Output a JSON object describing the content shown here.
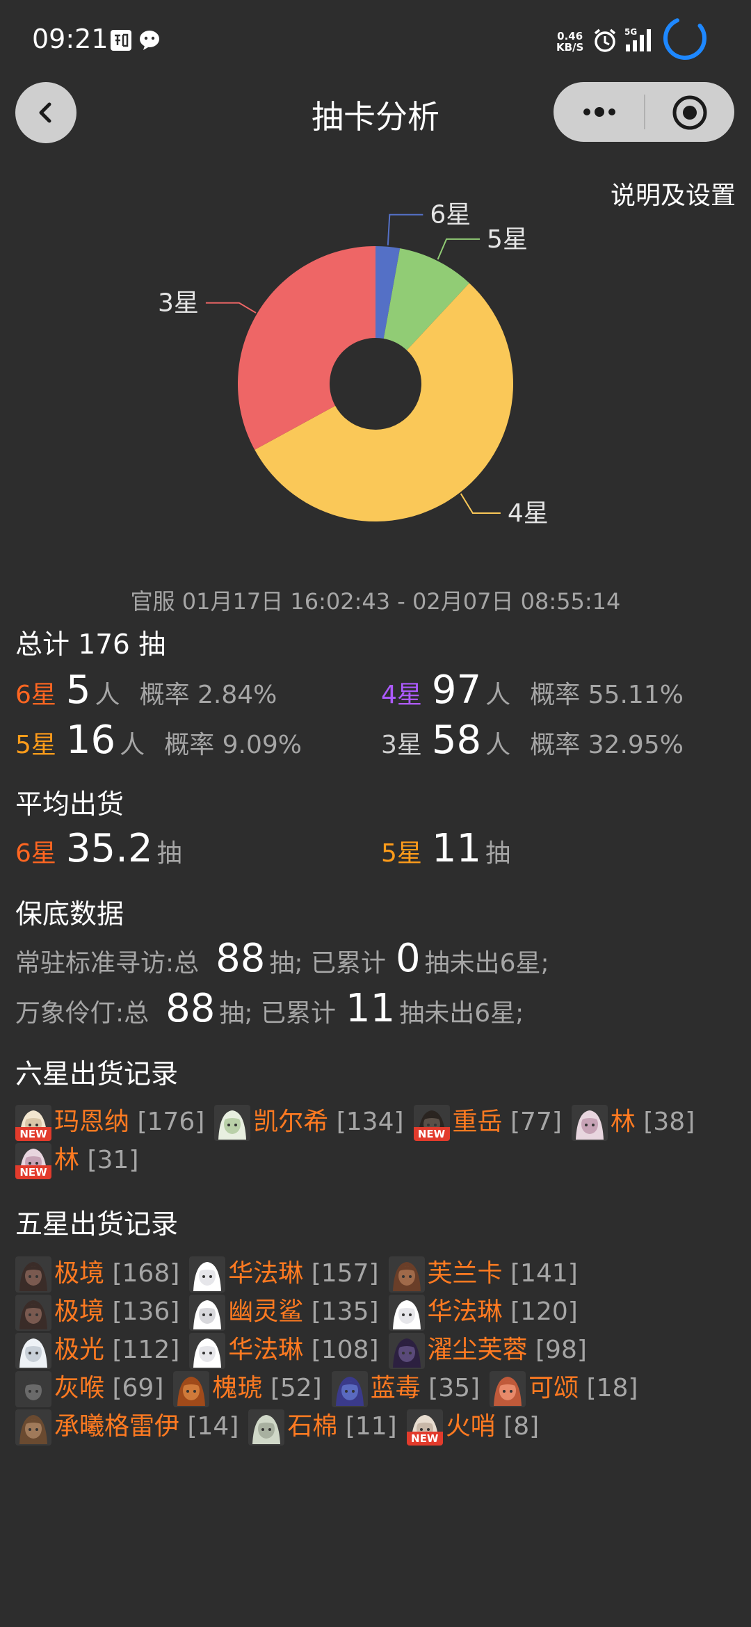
{
  "status": {
    "time": "09:21",
    "net_speed_top": "0.46",
    "net_speed_unit": "KB/S",
    "signal_label": "5G"
  },
  "nav": {
    "title": "抽卡分析"
  },
  "settings_link": "说明及设置",
  "chart_data": {
    "type": "pie",
    "donut": true,
    "slices": [
      {
        "label": "6星",
        "value": 5,
        "color": "#5470c6"
      },
      {
        "label": "5星",
        "value": 16,
        "color": "#91cc75"
      },
      {
        "label": "4星",
        "value": 97,
        "color": "#fac858"
      },
      {
        "label": "3星",
        "value": 58,
        "color": "#ee6666"
      }
    ]
  },
  "date_range": "官服  01月17日 16:02:43  -  02月07日 08:55:14",
  "total": "总计 176 抽",
  "stats": {
    "six": {
      "label": "6星",
      "count": "5",
      "unit": "人",
      "rate": "概率 2.84%"
    },
    "four": {
      "label": "4星",
      "count": "97",
      "unit": "人",
      "rate": "概率 55.11%"
    },
    "five": {
      "label": "5星",
      "count": "16",
      "unit": "人",
      "rate": "概率 9.09%"
    },
    "three": {
      "label": "3星",
      "count": "58",
      "unit": "人",
      "rate": "概率 32.95%"
    }
  },
  "avg_title": "平均出货",
  "avg": {
    "six": {
      "label": "6星",
      "value": "35.2",
      "unit": "抽"
    },
    "five": {
      "label": "5星",
      "value": "11",
      "unit": "抽"
    }
  },
  "pity_title": "保底数据",
  "pity": [
    {
      "name": "常驻标准寻访:总",
      "total": "88",
      "mid": "抽;  已累计",
      "acc": "0",
      "tail": "抽未出6星;"
    },
    {
      "name": "万象伶仃:总",
      "total": "88",
      "mid": "抽;  已累计",
      "acc": "11",
      "tail": "抽未出6星;"
    }
  ],
  "six_title": "六星出货记录",
  "six_records": [
    {
      "name": "玛恩纳",
      "count": "[176]",
      "new": true,
      "avatar_color": "#d9c7a8",
      "hair": "#f2e6cf"
    },
    {
      "name": "凯尔希",
      "count": "[134]",
      "new": false,
      "avatar_color": "#b9d0a8",
      "hair": "#e8efe0"
    },
    {
      "name": "重岳",
      "count": "[77]",
      "new": true,
      "avatar_color": "#5a5048",
      "hair": "#2a2420"
    },
    {
      "name": "林",
      "count": "[38]",
      "new": false,
      "avatar_color": "#c7a3b6",
      "hair": "#e8d6df"
    },
    {
      "name": "林",
      "count": "[31]",
      "new": true,
      "avatar_color": "#c7a3b6",
      "hair": "#e8d6df"
    }
  ],
  "new_tag": "NEW",
  "five_title": "五星出货记录",
  "five_records": [
    {
      "name": "极境",
      "count": "[168]",
      "new": false,
      "avatar_color": "#7a5a50",
      "hair": "#3a2c28"
    },
    {
      "name": "华法琳",
      "count": "[157]",
      "new": false,
      "avatar_color": "#e6e6ea",
      "hair": "#ffffff"
    },
    {
      "name": "芙兰卡",
      "count": "[141]",
      "new": false,
      "avatar_color": "#a06a4a",
      "hair": "#6a3e28"
    },
    {
      "name": "极境",
      "count": "[136]",
      "new": false,
      "avatar_color": "#7a5a50",
      "hair": "#3a2c28"
    },
    {
      "name": "幽灵鲨",
      "count": "[135]",
      "new": false,
      "avatar_color": "#d8d8dc",
      "hair": "#ffffff"
    },
    {
      "name": "华法琳",
      "count": "[120]",
      "new": false,
      "avatar_color": "#e6e6ea",
      "hair": "#ffffff"
    },
    {
      "name": "极光",
      "count": "[112]",
      "new": false,
      "avatar_color": "#c8d0d8",
      "hair": "#eef2f6"
    },
    {
      "name": "华法琳",
      "count": "[108]",
      "new": false,
      "avatar_color": "#e6e6ea",
      "hair": "#ffffff"
    },
    {
      "name": "濯尘芙蓉",
      "count": "[98]",
      "new": false,
      "avatar_color": "#5a4a7a",
      "hair": "#2c2040"
    },
    {
      "name": "灰喉",
      "count": "[69]",
      "new": false,
      "avatar_color": "#6a6a6a",
      "hair": "#3a3a3a"
    },
    {
      "name": "槐琥",
      "count": "[52]",
      "new": false,
      "avatar_color": "#d07a3a",
      "hair": "#a04a1a"
    },
    {
      "name": "蓝毒",
      "count": "[35]",
      "new": false,
      "avatar_color": "#5a6ac0",
      "hair": "#3a3a8a"
    },
    {
      "name": "可颂",
      "count": "[18]",
      "new": false,
      "avatar_color": "#e88a6a",
      "hair": "#c05a3a"
    },
    {
      "name": "承曦格雷伊",
      "count": "[14]",
      "new": false,
      "avatar_color": "#a07a5a",
      "hair": "#6a4a30"
    },
    {
      "name": "石棉",
      "count": "[11]",
      "new": false,
      "avatar_color": "#a8b0a0",
      "hair": "#d0d8c8"
    },
    {
      "name": "火哨",
      "count": "[8]",
      "new": true,
      "avatar_color": "#c8b8a8",
      "hair": "#e8ddd0"
    }
  ]
}
